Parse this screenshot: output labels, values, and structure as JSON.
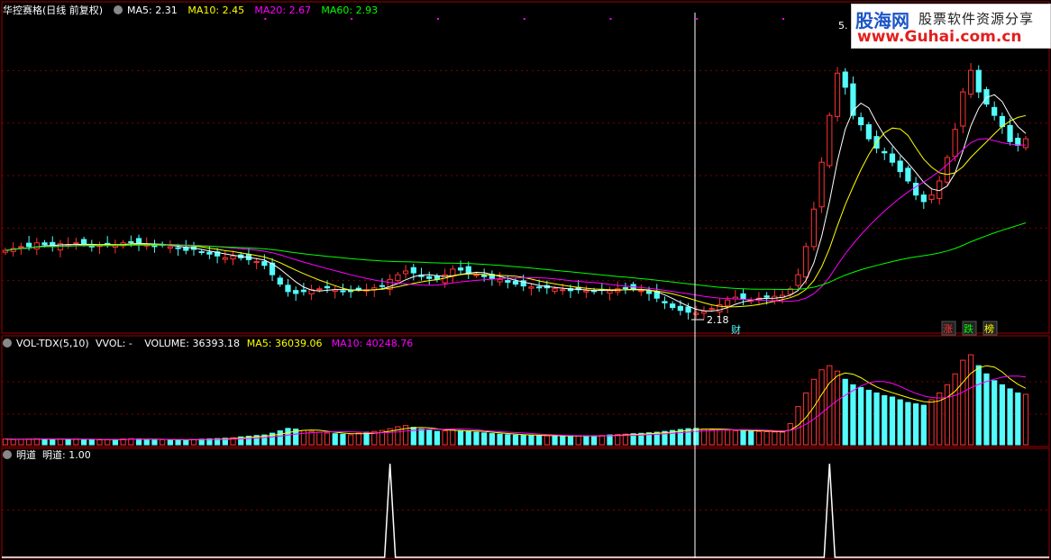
{
  "main_panel": {
    "title": "华控赛格(日线 前复权)",
    "ma_labels": [
      {
        "text": "MA5: 2.31",
        "color": "#ffffff"
      },
      {
        "text": "MA10: 2.45",
        "color": "#ffff00"
      },
      {
        "text": "MA20: 2.67",
        "color": "#ff00ff"
      },
      {
        "text": "MA60: 2.93",
        "color": "#00ff00"
      }
    ],
    "min_price_label": "2.18",
    "max_price_label": "5.",
    "cai_label": "财",
    "badges": [
      {
        "text": "涨",
        "color": "#ff3333"
      },
      {
        "text": "跌",
        "color": "#00ff00"
      },
      {
        "text": "榜",
        "color": "#ffff00"
      }
    ]
  },
  "volume_panel": {
    "title": "VOL-TDX(5,10)",
    "labels": [
      {
        "text": "VVOL: -",
        "color": "#ffffff"
      },
      {
        "text": "VOLUME: 36393.18",
        "color": "#ffffff"
      },
      {
        "text": "MA5: 36039.06",
        "color": "#ffff00"
      },
      {
        "text": "MA10: 40248.76",
        "color": "#ff00ff"
      }
    ]
  },
  "mingdao_panel": {
    "title": "明道",
    "labels": [
      {
        "text": "明道: 1.00",
        "color": "#ffffff"
      }
    ]
  },
  "watermark": {
    "brand": "股海网",
    "slogan": "股票软件资源分享",
    "url": "www.Guhai.com.cn"
  },
  "colors": {
    "up": "#ff3333",
    "down": "#54fcfc",
    "ma5": "#ffffff",
    "ma10": "#ffff00",
    "ma20": "#ff00ff",
    "ma60": "#00ff00",
    "grid": "#800000",
    "frame": "#a00000"
  },
  "chart_data": [
    {
      "type": "candlestick",
      "x_index": "trading day",
      "price_range": [
        2.15,
        5.3
      ],
      "overlays": [
        "MA5",
        "MA10",
        "MA20",
        "MA60"
      ],
      "close": [
        2.86,
        2.88,
        2.9,
        2.9,
        2.94,
        2.92,
        2.9,
        2.93,
        2.92,
        2.94,
        2.93,
        2.9,
        2.91,
        2.93,
        2.92,
        2.94,
        2.95,
        2.93,
        2.92,
        2.9,
        2.92,
        2.9,
        2.88,
        2.86,
        2.87,
        2.84,
        2.82,
        2.8,
        2.78,
        2.8,
        2.78,
        2.76,
        2.74,
        2.7,
        2.6,
        2.5,
        2.42,
        2.4,
        2.42,
        2.44,
        2.45,
        2.46,
        2.44,
        2.42,
        2.42,
        2.45,
        2.44,
        2.46,
        2.48,
        2.55,
        2.6,
        2.64,
        2.62,
        2.58,
        2.56,
        2.55,
        2.6,
        2.66,
        2.65,
        2.62,
        2.6,
        2.58,
        2.56,
        2.55,
        2.52,
        2.5,
        2.48,
        2.47,
        2.46,
        2.46,
        2.45,
        2.44,
        2.43,
        2.44,
        2.43,
        2.42,
        2.44,
        2.43,
        2.45,
        2.46,
        2.45,
        2.43,
        2.4,
        2.35,
        2.3,
        2.25,
        2.22,
        2.2,
        2.19,
        2.21,
        2.24,
        2.28,
        2.33,
        2.36,
        2.34,
        2.33,
        2.35,
        2.36,
        2.37,
        2.38,
        2.45,
        2.6,
        2.9,
        3.3,
        3.8,
        4.3,
        4.75,
        4.6,
        4.3,
        4.2,
        4.05,
        3.95,
        3.9,
        3.8,
        3.7,
        3.6,
        3.45,
        3.38,
        3.45,
        3.6,
        3.85,
        4.15,
        4.55,
        4.78,
        4.55,
        4.42,
        4.3,
        4.18,
        4.02,
        3.98,
        4.05
      ],
      "volume": [
        4.2,
        3.8,
        4,
        4.2,
        4.4,
        4.1,
        3.9,
        4.1,
        4,
        4.2,
        3.9,
        3.8,
        3.6,
        3.8,
        3.7,
        4.3,
        4.5,
        4.2,
        3.9,
        3.8,
        3.7,
        3.6,
        3.5,
        3.4,
        3.9,
        4.1,
        4.3,
        4.5,
        4.8,
        5.2,
        5.8,
        6.3,
        6.8,
        7.2,
        8.5,
        10.2,
        12,
        11.5,
        10.5,
        9.8,
        9.2,
        8.6,
        8.1,
        7.7,
        7.3,
        8.5,
        9.2,
        9.8,
        10.5,
        11.8,
        13.2,
        14.1,
        12.8,
        11.5,
        10.6,
        9.8,
        10.2,
        11,
        10.4,
        9.8,
        9.2,
        8.7,
        8.2,
        7.8,
        7.4,
        7.1,
        6.9,
        6.8,
        6.7,
        6.6,
        6.5,
        6.3,
        6.2,
        6.4,
        6.5,
        6.6,
        6.8,
        7.2,
        7.5,
        7.8,
        8.1,
        8.4,
        8.8,
        9.2,
        9.8,
        10.5,
        11.2,
        11.8,
        12,
        11.6,
        11.2,
        10.9,
        10.6,
        10.2,
        10.4,
        10.1,
        9.8,
        9.6,
        9.4,
        9.2,
        15.5,
        28,
        38,
        48,
        55,
        58,
        54,
        48,
        44,
        42,
        40,
        38,
        36,
        35,
        33,
        31,
        30,
        29,
        33,
        38,
        44,
        52,
        62,
        66,
        58,
        52,
        47,
        44,
        41,
        38,
        37
      ]
    },
    {
      "type": "line",
      "name": "明道",
      "y_range": [
        0,
        1
      ],
      "signals": [
        49,
        105
      ]
    }
  ]
}
